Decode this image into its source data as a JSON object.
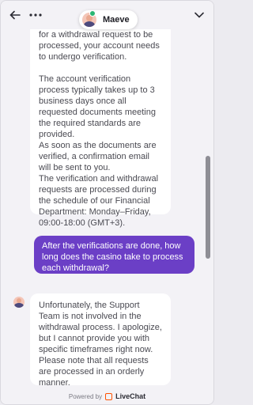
{
  "header": {
    "agent_name": "Maeve"
  },
  "messages": [
    {
      "from": "agent",
      "paragraphs": [
        "for a withdrawal request to be processed, your account needs to undergo verification.",
        "The account verification process typically takes up to 3 business days once all requested documents meeting the required standards are provided.",
        "As soon as the documents are verified, a confirmation email will be sent to you.",
        "The verification and withdrawal requests are processed during the schedule of our Financial Department: Monday–Friday, 09:00-18:00 (GMT+3)."
      ]
    },
    {
      "from": "user",
      "text": "After the verifications are done, how long does the casino take to process each withdrawal?"
    },
    {
      "from": "agent",
      "text": "Unfortunately, the Support Team is not involved in the withdrawal process. I apologize, but I cannot provide you with specific timeframes right now. Please note that all requests are processed in an orderly manner."
    }
  ],
  "footer": {
    "powered_by": "Powered by",
    "brand": "LiveChat"
  },
  "colors": {
    "user_bubble": "#6b3fc6",
    "brand": "#ff5100",
    "online": "#2bb673"
  }
}
